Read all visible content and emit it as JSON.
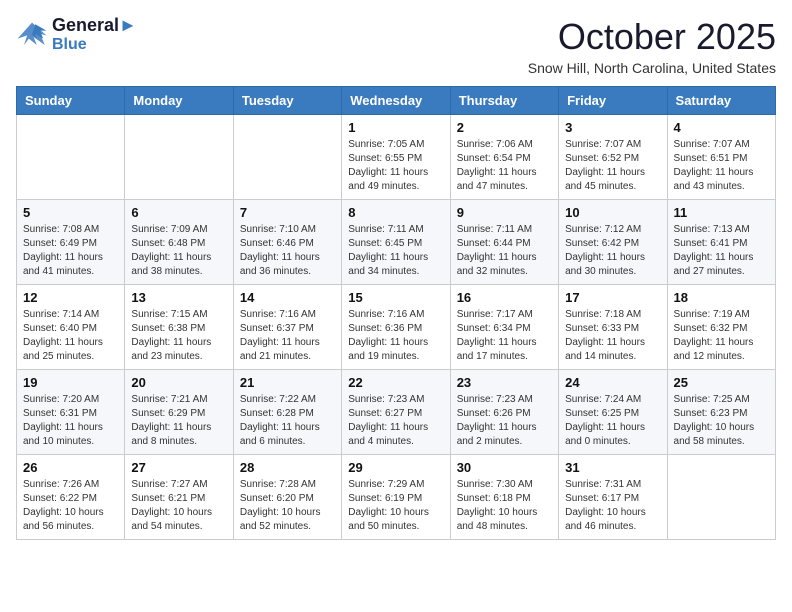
{
  "header": {
    "logo_line1": "General",
    "logo_line2": "Blue",
    "month": "October 2025",
    "location": "Snow Hill, North Carolina, United States"
  },
  "days_of_week": [
    "Sunday",
    "Monday",
    "Tuesday",
    "Wednesday",
    "Thursday",
    "Friday",
    "Saturday"
  ],
  "weeks": [
    [
      {
        "day": "",
        "info": ""
      },
      {
        "day": "",
        "info": ""
      },
      {
        "day": "",
        "info": ""
      },
      {
        "day": "1",
        "info": "Sunrise: 7:05 AM\nSunset: 6:55 PM\nDaylight: 11 hours and 49 minutes."
      },
      {
        "day": "2",
        "info": "Sunrise: 7:06 AM\nSunset: 6:54 PM\nDaylight: 11 hours and 47 minutes."
      },
      {
        "day": "3",
        "info": "Sunrise: 7:07 AM\nSunset: 6:52 PM\nDaylight: 11 hours and 45 minutes."
      },
      {
        "day": "4",
        "info": "Sunrise: 7:07 AM\nSunset: 6:51 PM\nDaylight: 11 hours and 43 minutes."
      }
    ],
    [
      {
        "day": "5",
        "info": "Sunrise: 7:08 AM\nSunset: 6:49 PM\nDaylight: 11 hours and 41 minutes."
      },
      {
        "day": "6",
        "info": "Sunrise: 7:09 AM\nSunset: 6:48 PM\nDaylight: 11 hours and 38 minutes."
      },
      {
        "day": "7",
        "info": "Sunrise: 7:10 AM\nSunset: 6:46 PM\nDaylight: 11 hours and 36 minutes."
      },
      {
        "day": "8",
        "info": "Sunrise: 7:11 AM\nSunset: 6:45 PM\nDaylight: 11 hours and 34 minutes."
      },
      {
        "day": "9",
        "info": "Sunrise: 7:11 AM\nSunset: 6:44 PM\nDaylight: 11 hours and 32 minutes."
      },
      {
        "day": "10",
        "info": "Sunrise: 7:12 AM\nSunset: 6:42 PM\nDaylight: 11 hours and 30 minutes."
      },
      {
        "day": "11",
        "info": "Sunrise: 7:13 AM\nSunset: 6:41 PM\nDaylight: 11 hours and 27 minutes."
      }
    ],
    [
      {
        "day": "12",
        "info": "Sunrise: 7:14 AM\nSunset: 6:40 PM\nDaylight: 11 hours and 25 minutes."
      },
      {
        "day": "13",
        "info": "Sunrise: 7:15 AM\nSunset: 6:38 PM\nDaylight: 11 hours and 23 minutes."
      },
      {
        "day": "14",
        "info": "Sunrise: 7:16 AM\nSunset: 6:37 PM\nDaylight: 11 hours and 21 minutes."
      },
      {
        "day": "15",
        "info": "Sunrise: 7:16 AM\nSunset: 6:36 PM\nDaylight: 11 hours and 19 minutes."
      },
      {
        "day": "16",
        "info": "Sunrise: 7:17 AM\nSunset: 6:34 PM\nDaylight: 11 hours and 17 minutes."
      },
      {
        "day": "17",
        "info": "Sunrise: 7:18 AM\nSunset: 6:33 PM\nDaylight: 11 hours and 14 minutes."
      },
      {
        "day": "18",
        "info": "Sunrise: 7:19 AM\nSunset: 6:32 PM\nDaylight: 11 hours and 12 minutes."
      }
    ],
    [
      {
        "day": "19",
        "info": "Sunrise: 7:20 AM\nSunset: 6:31 PM\nDaylight: 11 hours and 10 minutes."
      },
      {
        "day": "20",
        "info": "Sunrise: 7:21 AM\nSunset: 6:29 PM\nDaylight: 11 hours and 8 minutes."
      },
      {
        "day": "21",
        "info": "Sunrise: 7:22 AM\nSunset: 6:28 PM\nDaylight: 11 hours and 6 minutes."
      },
      {
        "day": "22",
        "info": "Sunrise: 7:23 AM\nSunset: 6:27 PM\nDaylight: 11 hours and 4 minutes."
      },
      {
        "day": "23",
        "info": "Sunrise: 7:23 AM\nSunset: 6:26 PM\nDaylight: 11 hours and 2 minutes."
      },
      {
        "day": "24",
        "info": "Sunrise: 7:24 AM\nSunset: 6:25 PM\nDaylight: 11 hours and 0 minutes."
      },
      {
        "day": "25",
        "info": "Sunrise: 7:25 AM\nSunset: 6:23 PM\nDaylight: 10 hours and 58 minutes."
      }
    ],
    [
      {
        "day": "26",
        "info": "Sunrise: 7:26 AM\nSunset: 6:22 PM\nDaylight: 10 hours and 56 minutes."
      },
      {
        "day": "27",
        "info": "Sunrise: 7:27 AM\nSunset: 6:21 PM\nDaylight: 10 hours and 54 minutes."
      },
      {
        "day": "28",
        "info": "Sunrise: 7:28 AM\nSunset: 6:20 PM\nDaylight: 10 hours and 52 minutes."
      },
      {
        "day": "29",
        "info": "Sunrise: 7:29 AM\nSunset: 6:19 PM\nDaylight: 10 hours and 50 minutes."
      },
      {
        "day": "30",
        "info": "Sunrise: 7:30 AM\nSunset: 6:18 PM\nDaylight: 10 hours and 48 minutes."
      },
      {
        "day": "31",
        "info": "Sunrise: 7:31 AM\nSunset: 6:17 PM\nDaylight: 10 hours and 46 minutes."
      },
      {
        "day": "",
        "info": ""
      }
    ]
  ]
}
